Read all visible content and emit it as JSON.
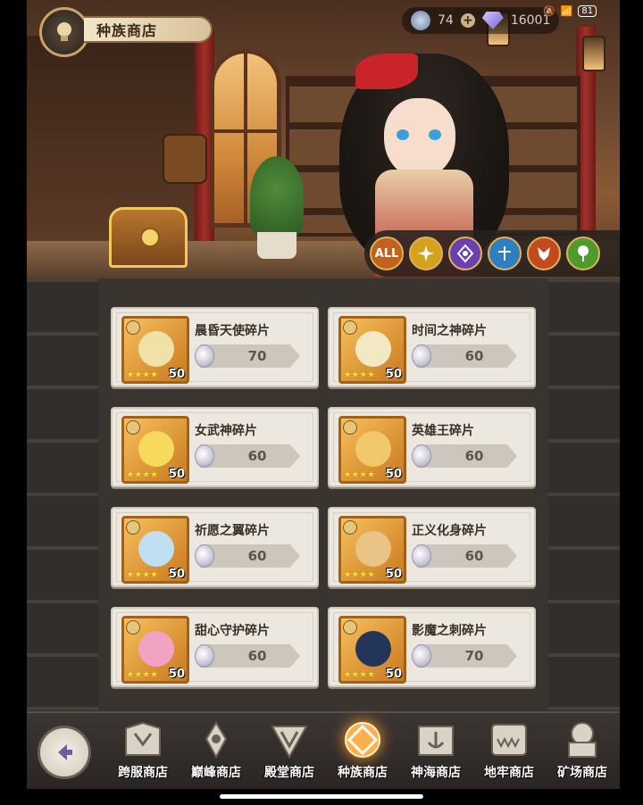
{
  "header": {
    "title": "种族商店",
    "currency_amount": "74",
    "gem_amount": "16001"
  },
  "status_bar": {
    "battery": "81"
  },
  "filters": [
    {
      "label": "ALL",
      "color": "#c2621e"
    },
    {
      "label": "",
      "icon": "light-faction-icon",
      "color": "#d4a21f"
    },
    {
      "label": "",
      "icon": "dark-faction-icon",
      "color": "#6a3fb0"
    },
    {
      "label": "",
      "icon": "water-faction-icon",
      "color": "#2e7fc2"
    },
    {
      "label": "",
      "icon": "fire-faction-icon",
      "color": "#c24a1e"
    },
    {
      "label": "",
      "icon": "nature-faction-icon",
      "color": "#4e9a2a"
    }
  ],
  "shop_items": [
    {
      "name": "晨昏天使碎片",
      "price": "70",
      "stars": "★★★★",
      "qty": "50",
      "hero_color": "#efe1a8"
    },
    {
      "name": "时间之神碎片",
      "price": "60",
      "stars": "★★★★",
      "qty": "50",
      "hero_color": "#f2e9c4"
    },
    {
      "name": "女武神碎片",
      "price": "60",
      "stars": "★★★★",
      "qty": "50",
      "hero_color": "#f7d95c"
    },
    {
      "name": "英雄王碎片",
      "price": "60",
      "stars": "★★★★",
      "qty": "50",
      "hero_color": "#f1c96b"
    },
    {
      "name": "祈愿之翼碎片",
      "price": "60",
      "stars": "★★★★",
      "qty": "50",
      "hero_color": "#bfe0f2"
    },
    {
      "name": "正义化身碎片",
      "price": "60",
      "stars": "★★★★",
      "qty": "50",
      "hero_color": "#e9c486"
    },
    {
      "name": "甜心守护碎片",
      "price": "60",
      "stars": "★★★★",
      "qty": "50",
      "hero_color": "#f2a3c4"
    },
    {
      "name": "影魔之刺碎片",
      "price": "70",
      "stars": "★★★★",
      "qty": "50",
      "hero_color": "#23365a"
    }
  ],
  "nav": [
    {
      "label": "跨服商店"
    },
    {
      "label": "巅峰商店"
    },
    {
      "label": "殿堂商店"
    },
    {
      "label": "种族商店",
      "active": true
    },
    {
      "label": "神海商店"
    },
    {
      "label": "地牢商店"
    },
    {
      "label": "矿场商店"
    }
  ]
}
